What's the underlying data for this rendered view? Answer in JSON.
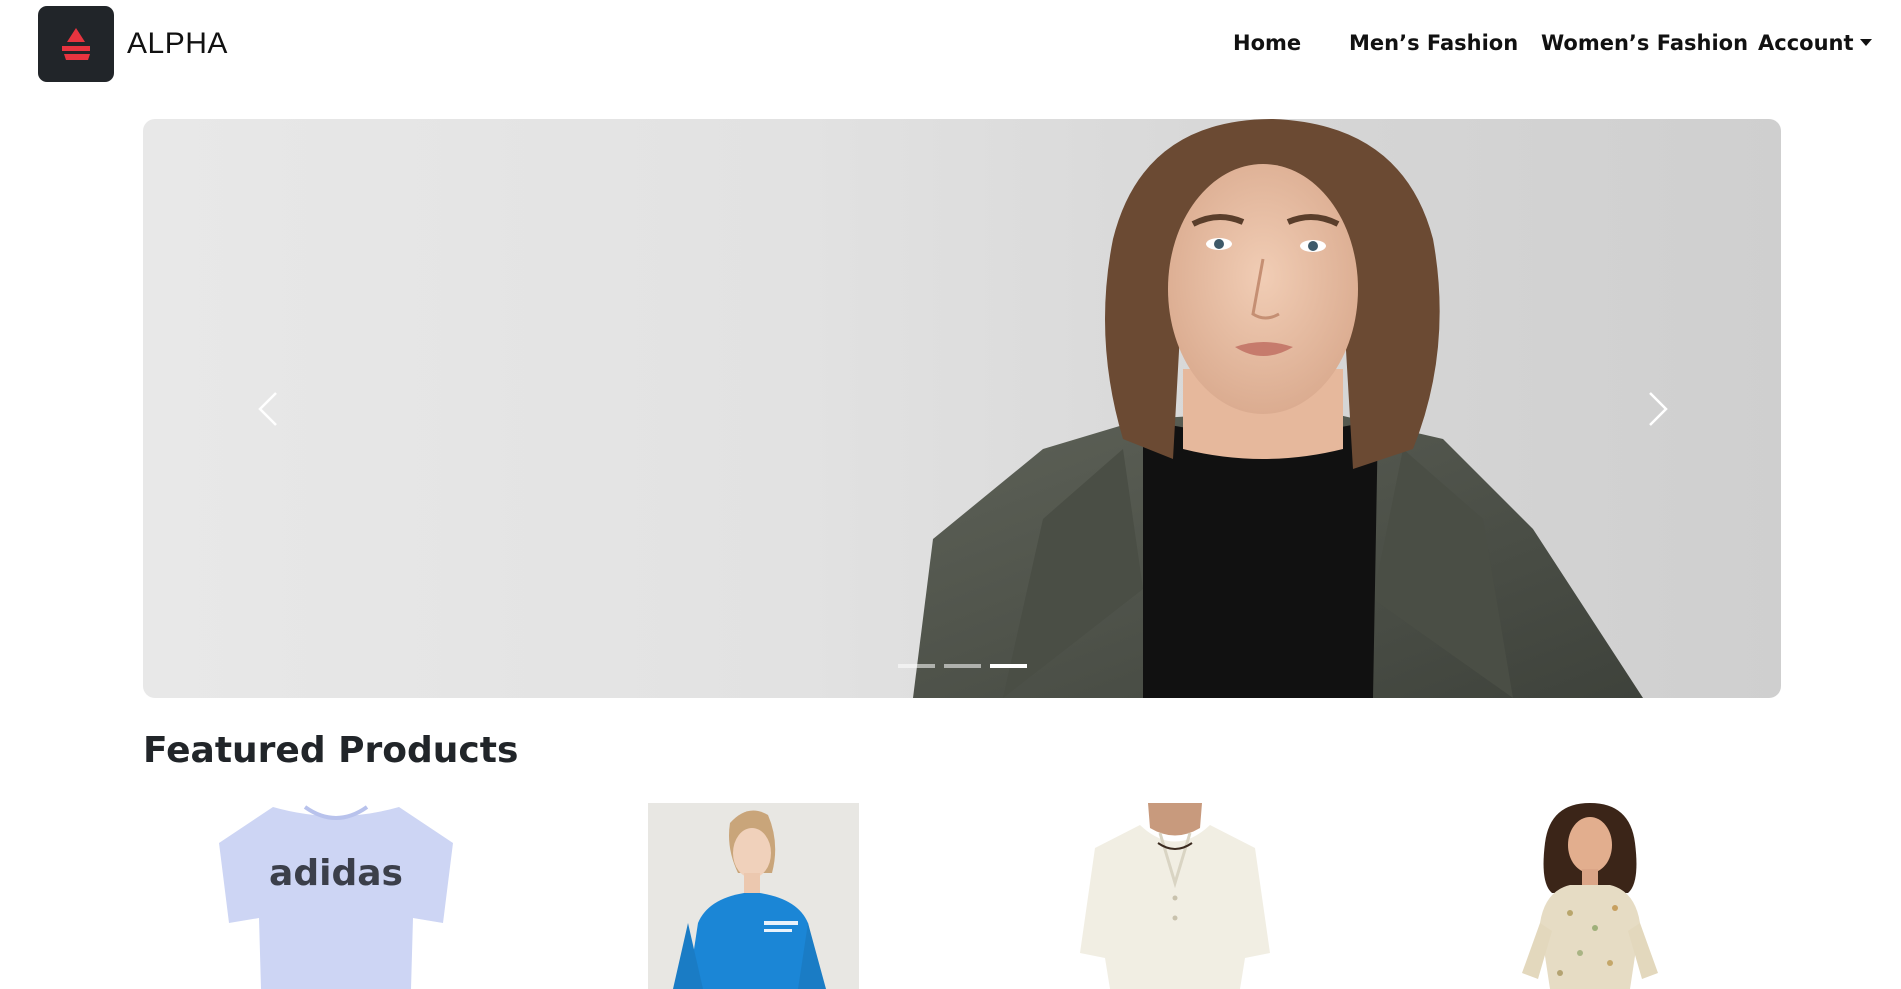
{
  "brand": {
    "name": "ALPHA",
    "logo_icon": "alpha-logo-icon",
    "logo_bg": "#212529",
    "logo_accent": "#e8343f"
  },
  "nav": {
    "items": [
      {
        "label": "Home"
      },
      {
        "label": "Men’s Fashion"
      },
      {
        "label": "Women’s Fashion"
      },
      {
        "label": "Account",
        "dropdown": true
      }
    ]
  },
  "carousel": {
    "prev_icon": "chevron-left-icon",
    "next_icon": "chevron-right-icon",
    "slides_count": 3,
    "active_index": 2
  },
  "featured": {
    "title": "Featured Products",
    "products": [
      {
        "image": "adidas t-shirt",
        "shirt_text": "adidas"
      },
      {
        "image": "blue sweatshirt"
      },
      {
        "image": "white linen shirt"
      },
      {
        "image": "floral dress"
      }
    ]
  }
}
